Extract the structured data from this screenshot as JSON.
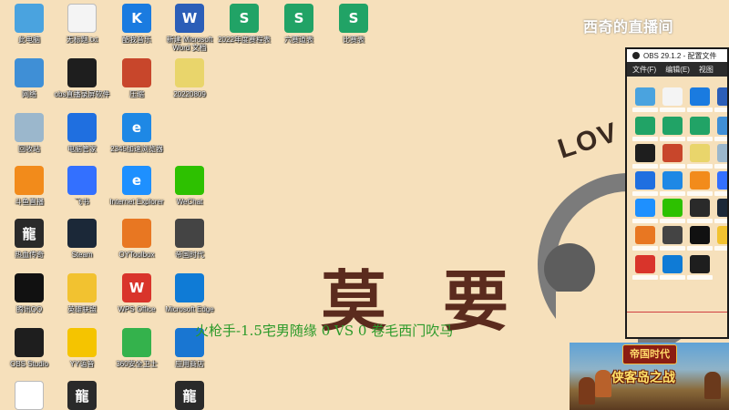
{
  "watermark": "西奇的直播间",
  "overlay_score": "火枪手-1.5宅男随缘   0  VS  0  卷毛西门吹马",
  "wallpaper": {
    "big_text": [
      "莫",
      "要"
    ],
    "love_text": "LOV"
  },
  "desktop_icons": [
    {
      "label": "此电脑",
      "icon": "computer-icon",
      "color": "#4aa3df"
    },
    {
      "label": "无标题.txt",
      "icon": "text-file-icon",
      "color": "#f4f4f4"
    },
    {
      "label": "酷我音乐",
      "icon": "kuwo-music-icon",
      "color": "#1a7be0",
      "glyph": "K"
    },
    {
      "label": "新建 Microsoft Word 文档",
      "icon": "word-doc-icon",
      "color": "#2b5eb8",
      "glyph": "W"
    },
    {
      "label": "2022年度赛程表",
      "icon": "wps-sheet-icon",
      "color": "#21a366",
      "glyph": "S"
    },
    {
      "label": "六赛道表",
      "icon": "wps-sheet-icon",
      "color": "#21a366",
      "glyph": "S"
    },
    {
      "label": "比赛表",
      "icon": "wps-sheet-icon",
      "color": "#21a366",
      "glyph": "S"
    },
    {
      "label": "网络",
      "icon": "network-icon",
      "color": "#3f8fd6"
    },
    {
      "label": "obs直播录屏软件",
      "icon": "obs-icon",
      "color": "#1e1e1e"
    },
    {
      "label": "压缩",
      "icon": "archive-icon",
      "color": "#c8462b"
    },
    {
      "label": "20220809",
      "icon": "folder-icon",
      "color": "#e9d56b"
    },
    {
      "label": "回收站",
      "icon": "recycle-bin-icon",
      "color": "#9bb7cc"
    },
    {
      "label": "电脑管家",
      "icon": "pc-manager-icon",
      "color": "#1f6fe0"
    },
    {
      "label": "2345加速浏览器",
      "icon": "browser-icon",
      "color": "#1e88e5",
      "glyph": "e"
    },
    {
      "label": "斗鱼直播",
      "icon": "douyu-icon",
      "color": "#f28b1b"
    },
    {
      "label": "飞书",
      "icon": "feishu-icon",
      "color": "#3370ff"
    },
    {
      "label": "Internet Explorer",
      "icon": "ie-icon",
      "color": "#1e90ff",
      "glyph": "e"
    },
    {
      "label": "WeChat",
      "icon": "wechat-icon",
      "color": "#2dc100"
    },
    {
      "label": "热血传奇",
      "icon": "legend-game-icon",
      "color": "#2a2a2a",
      "glyph": "龍"
    },
    {
      "label": "Steam",
      "icon": "steam-icon",
      "color": "#1b2838"
    },
    {
      "label": "OYToolbox",
      "icon": "toolbox-icon",
      "color": "#e87722"
    },
    {
      "label": "帝国时代",
      "icon": "aoe-icon",
      "color": "#444444"
    },
    {
      "label": "腾讯QQ",
      "icon": "qq-icon",
      "color": "#111111"
    },
    {
      "label": "英雄联盟",
      "icon": "lol-icon",
      "color": "#f2c230"
    },
    {
      "label": "WPS Office",
      "icon": "wps-icon",
      "color": "#d9342b",
      "glyph": "W"
    },
    {
      "label": "Microsoft Edge",
      "icon": "edge-icon",
      "color": "#0f7bd6"
    },
    {
      "label": "OBS Studio",
      "icon": "obs-icon",
      "color": "#1e1e1e"
    },
    {
      "label": "YY语音",
      "icon": "yy-icon",
      "color": "#f5c400"
    },
    {
      "label": "360安全卫士",
      "icon": "security-icon",
      "color": "#34b24c"
    },
    {
      "label": "应用商店",
      "icon": "store-icon",
      "color": "#1976d2"
    },
    {
      "label": "",
      "icon": "bear-icon",
      "color": "#ffffff"
    },
    {
      "label": "",
      "icon": "legend-game-icon",
      "color": "#2a2a2a",
      "glyph": "龍"
    },
    {
      "label": "",
      "icon": "legend-game-icon",
      "color": "#2a2a2a",
      "glyph": "龍"
    }
  ],
  "obs_window": {
    "title": "OBS 29.1.2 - 配置文件",
    "menu": [
      "文件(F)",
      "编辑(E)",
      "视图"
    ]
  },
  "ad_banner": {
    "logo": "帝国时代",
    "title": "侠客岛之战"
  }
}
